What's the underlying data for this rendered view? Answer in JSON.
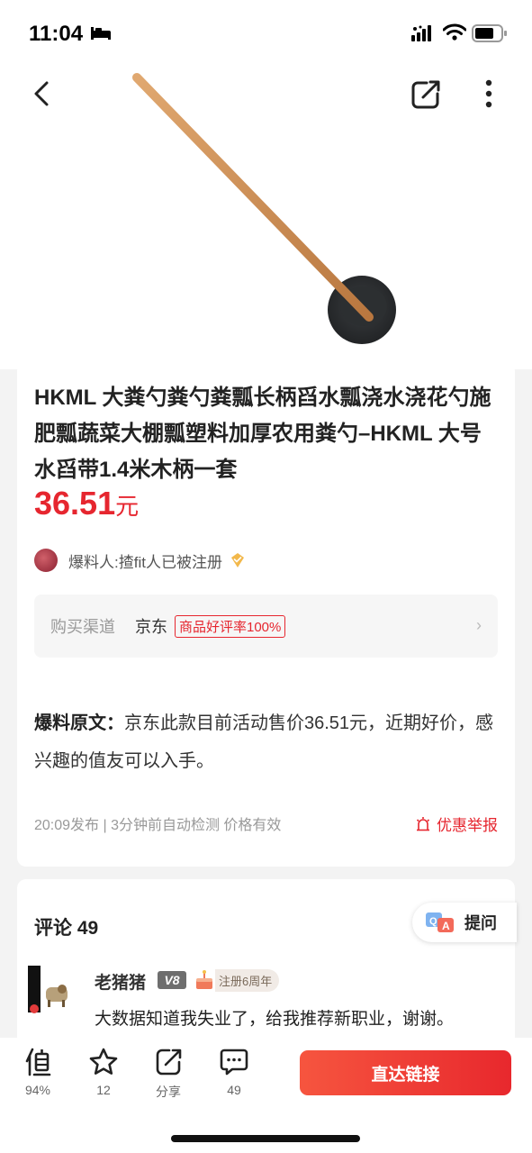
{
  "status": {
    "time": "11:04"
  },
  "product": {
    "title": "HKML 大粪勺粪勺粪瓢长柄舀水瓢浇水浇花勺施肥瓢蔬菜大棚瓢塑料加厚农用粪勺–HKML 大号水舀带1.4米木柄一套",
    "price": "36.51",
    "price_unit": "元",
    "price_color": "#e6262f"
  },
  "author": {
    "label": "爆料人:",
    "name": "揸fit人已被注册"
  },
  "channel": {
    "label": "购买渠道",
    "store": "京东",
    "tag": "商品好评率100%",
    "chevron": "›"
  },
  "content": {
    "label": "爆料原文：",
    "text": "京东此款目前活动售价36.51元，近期好价，感兴趣的值友可以入手。"
  },
  "meta": {
    "published": "20:09发布 | 3分钟前自动检测 价格有效",
    "report": "优惠举报"
  },
  "comments": {
    "title": "评论 49",
    "ask_label": "提问",
    "first": {
      "user": "老猪猪",
      "level": "V8",
      "anniversary": "注册6周年",
      "text": "大数据知道我失业了，给我推荐新职业，谢谢。"
    }
  },
  "bottom_bar": {
    "worth": {
      "icon": "worth-icon",
      "label": "94%"
    },
    "favorite": {
      "icon": "star-icon",
      "label": "12"
    },
    "share": {
      "icon": "share-icon",
      "label": "分享"
    },
    "comment": {
      "icon": "comment-icon",
      "label": "49"
    },
    "go_button": "直达链接",
    "accent": "#e8282d"
  }
}
